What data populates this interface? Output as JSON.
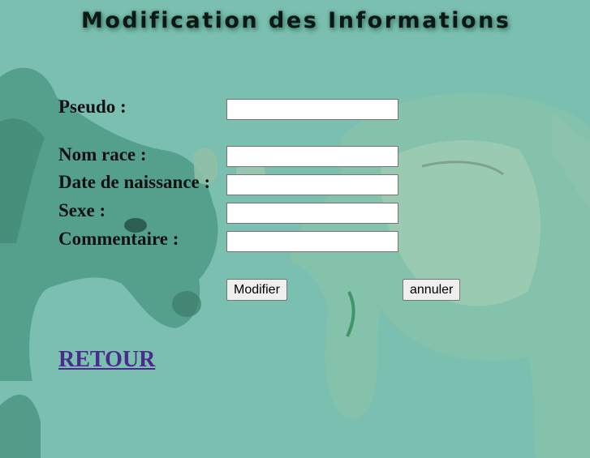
{
  "page": {
    "title": "Modification des Informations"
  },
  "form": {
    "fields": [
      {
        "label": "Pseudo :",
        "value": ""
      },
      {
        "label": "Nom race :",
        "value": ""
      },
      {
        "label": "Date de naissance :",
        "value": ""
      },
      {
        "label": "Sexe :",
        "value": ""
      },
      {
        "label": "Commentaire :",
        "value": ""
      }
    ],
    "submit_label": "Modifier",
    "cancel_label": "annuler"
  },
  "nav": {
    "back_link": "RETOUR"
  },
  "colors": {
    "background": "#7bbfb0",
    "link": "#4b2a8d"
  }
}
